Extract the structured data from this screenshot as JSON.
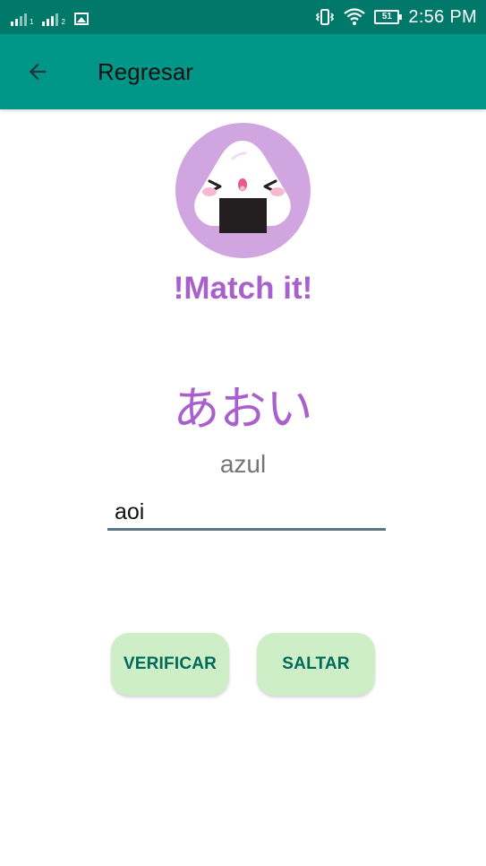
{
  "status_bar": {
    "time": "2:56 PM",
    "battery_level": "51",
    "sim1_label": "1",
    "sim2_label": "2",
    "color": "#00796b"
  },
  "app_bar": {
    "title": "Regresar",
    "back_icon": "arrow-back-icon",
    "color": "#009688"
  },
  "logo": {
    "icon": "onigiri-mascot-icon",
    "circle_color": "#d1a5e0"
  },
  "app_name": "!Match it!",
  "card": {
    "kana": "あおい",
    "meaning": "azul"
  },
  "answer": {
    "value": "aoi"
  },
  "buttons": {
    "verify_label": "VERIFICAR",
    "skip_label": "SALTAR",
    "background": "#cdeec6",
    "text_color": "#00695c"
  },
  "accent": "#a860cc"
}
